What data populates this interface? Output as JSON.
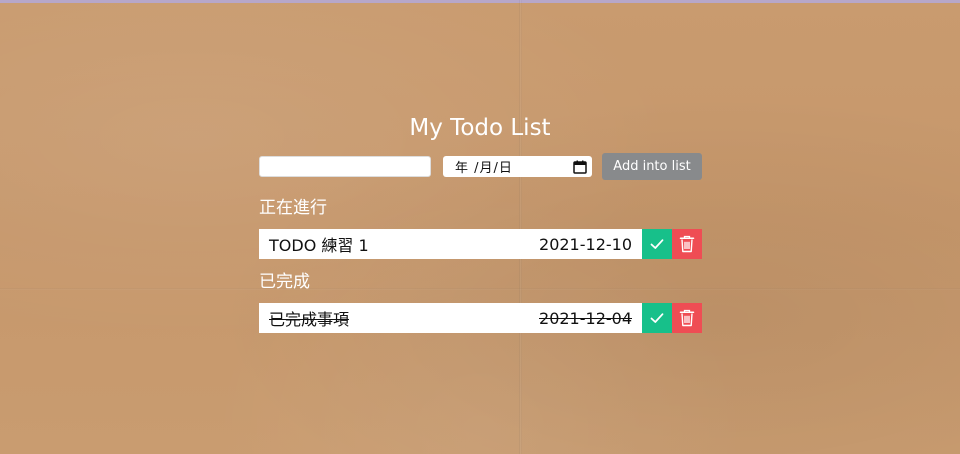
{
  "app": {
    "title": "My Todo List"
  },
  "form": {
    "text_value": "",
    "date_placeholder": "年 /月/日",
    "add_label": "Add into list"
  },
  "sections": {
    "in_progress": {
      "heading": "正在進行",
      "items": [
        {
          "name": "TODO 練習 1",
          "date": "2021-12-10"
        }
      ]
    },
    "completed": {
      "heading": "已完成",
      "items": [
        {
          "name": "已完成事項",
          "date": "2021-12-04"
        }
      ]
    }
  },
  "icons": {
    "complete": "check-icon",
    "delete": "trash-icon",
    "calendar": "calendar-icon"
  },
  "colors": {
    "complete_button": "#17c08a",
    "delete_button": "#ef4d54",
    "add_button": "#888a8c"
  }
}
